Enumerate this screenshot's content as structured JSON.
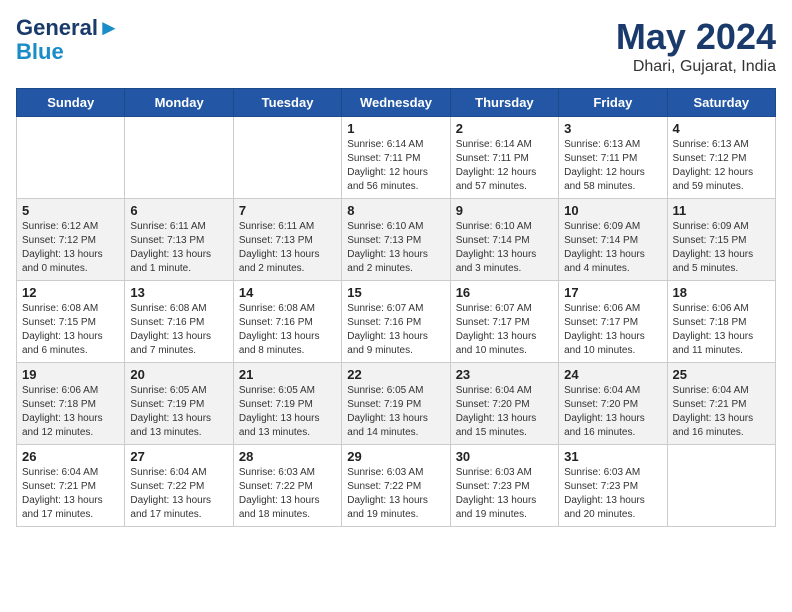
{
  "header": {
    "logo_line1": "General",
    "logo_line2": "Blue",
    "title": "May 2024",
    "subtitle": "Dhari, Gujarat, India"
  },
  "days": [
    "Sunday",
    "Monday",
    "Tuesday",
    "Wednesday",
    "Thursday",
    "Friday",
    "Saturday"
  ],
  "weeks": [
    [
      {
        "date": "",
        "info": ""
      },
      {
        "date": "",
        "info": ""
      },
      {
        "date": "",
        "info": ""
      },
      {
        "date": "1",
        "info": "Sunrise: 6:14 AM\nSunset: 7:11 PM\nDaylight: 12 hours and 56 minutes."
      },
      {
        "date": "2",
        "info": "Sunrise: 6:14 AM\nSunset: 7:11 PM\nDaylight: 12 hours and 57 minutes."
      },
      {
        "date": "3",
        "info": "Sunrise: 6:13 AM\nSunset: 7:11 PM\nDaylight: 12 hours and 58 minutes."
      },
      {
        "date": "4",
        "info": "Sunrise: 6:13 AM\nSunset: 7:12 PM\nDaylight: 12 hours and 59 minutes."
      }
    ],
    [
      {
        "date": "5",
        "info": "Sunrise: 6:12 AM\nSunset: 7:12 PM\nDaylight: 13 hours and 0 minutes."
      },
      {
        "date": "6",
        "info": "Sunrise: 6:11 AM\nSunset: 7:13 PM\nDaylight: 13 hours and 1 minute."
      },
      {
        "date": "7",
        "info": "Sunrise: 6:11 AM\nSunset: 7:13 PM\nDaylight: 13 hours and 2 minutes."
      },
      {
        "date": "8",
        "info": "Sunrise: 6:10 AM\nSunset: 7:13 PM\nDaylight: 13 hours and 2 minutes."
      },
      {
        "date": "9",
        "info": "Sunrise: 6:10 AM\nSunset: 7:14 PM\nDaylight: 13 hours and 3 minutes."
      },
      {
        "date": "10",
        "info": "Sunrise: 6:09 AM\nSunset: 7:14 PM\nDaylight: 13 hours and 4 minutes."
      },
      {
        "date": "11",
        "info": "Sunrise: 6:09 AM\nSunset: 7:15 PM\nDaylight: 13 hours and 5 minutes."
      }
    ],
    [
      {
        "date": "12",
        "info": "Sunrise: 6:08 AM\nSunset: 7:15 PM\nDaylight: 13 hours and 6 minutes."
      },
      {
        "date": "13",
        "info": "Sunrise: 6:08 AM\nSunset: 7:16 PM\nDaylight: 13 hours and 7 minutes."
      },
      {
        "date": "14",
        "info": "Sunrise: 6:08 AM\nSunset: 7:16 PM\nDaylight: 13 hours and 8 minutes."
      },
      {
        "date": "15",
        "info": "Sunrise: 6:07 AM\nSunset: 7:16 PM\nDaylight: 13 hours and 9 minutes."
      },
      {
        "date": "16",
        "info": "Sunrise: 6:07 AM\nSunset: 7:17 PM\nDaylight: 13 hours and 10 minutes."
      },
      {
        "date": "17",
        "info": "Sunrise: 6:06 AM\nSunset: 7:17 PM\nDaylight: 13 hours and 10 minutes."
      },
      {
        "date": "18",
        "info": "Sunrise: 6:06 AM\nSunset: 7:18 PM\nDaylight: 13 hours and 11 minutes."
      }
    ],
    [
      {
        "date": "19",
        "info": "Sunrise: 6:06 AM\nSunset: 7:18 PM\nDaylight: 13 hours and 12 minutes."
      },
      {
        "date": "20",
        "info": "Sunrise: 6:05 AM\nSunset: 7:19 PM\nDaylight: 13 hours and 13 minutes."
      },
      {
        "date": "21",
        "info": "Sunrise: 6:05 AM\nSunset: 7:19 PM\nDaylight: 13 hours and 13 minutes."
      },
      {
        "date": "22",
        "info": "Sunrise: 6:05 AM\nSunset: 7:19 PM\nDaylight: 13 hours and 14 minutes."
      },
      {
        "date": "23",
        "info": "Sunrise: 6:04 AM\nSunset: 7:20 PM\nDaylight: 13 hours and 15 minutes."
      },
      {
        "date": "24",
        "info": "Sunrise: 6:04 AM\nSunset: 7:20 PM\nDaylight: 13 hours and 16 minutes."
      },
      {
        "date": "25",
        "info": "Sunrise: 6:04 AM\nSunset: 7:21 PM\nDaylight: 13 hours and 16 minutes."
      }
    ],
    [
      {
        "date": "26",
        "info": "Sunrise: 6:04 AM\nSunset: 7:21 PM\nDaylight: 13 hours and 17 minutes."
      },
      {
        "date": "27",
        "info": "Sunrise: 6:04 AM\nSunset: 7:22 PM\nDaylight: 13 hours and 17 minutes."
      },
      {
        "date": "28",
        "info": "Sunrise: 6:03 AM\nSunset: 7:22 PM\nDaylight: 13 hours and 18 minutes."
      },
      {
        "date": "29",
        "info": "Sunrise: 6:03 AM\nSunset: 7:22 PM\nDaylight: 13 hours and 19 minutes."
      },
      {
        "date": "30",
        "info": "Sunrise: 6:03 AM\nSunset: 7:23 PM\nDaylight: 13 hours and 19 minutes."
      },
      {
        "date": "31",
        "info": "Sunrise: 6:03 AM\nSunset: 7:23 PM\nDaylight: 13 hours and 20 minutes."
      },
      {
        "date": "",
        "info": ""
      }
    ]
  ]
}
